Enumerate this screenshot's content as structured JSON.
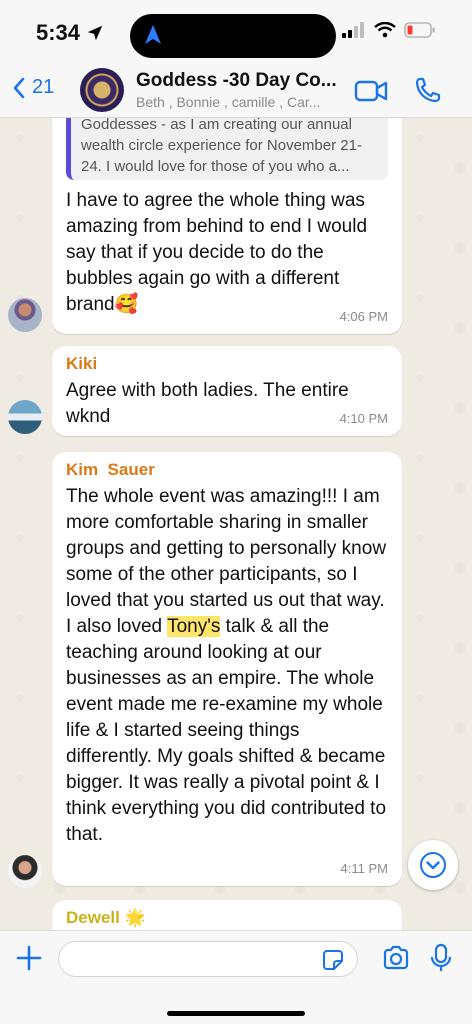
{
  "status_bar": {
    "time": "5:34"
  },
  "header": {
    "back_count": "21",
    "title": "Goddess -30 Day Co...",
    "subtitle": "Beth , Bonnie , camille , Car..."
  },
  "messages": [
    {
      "quote": "Goddesses - as I am creating our annual wealth circle experience for November 21-24. I would love for those of you who a...",
      "text": "I have to agree the whole thing was amazing from behind to end I would say that if you decide to do the bubbles again go with a different brand🥰",
      "time": "4:06 PM"
    },
    {
      "sender": "Kiki",
      "sender_color": "#d97a18",
      "text": "Agree with both ladies. The entire wknd",
      "time": "4:10 PM"
    },
    {
      "sender": "Kim  Sauer",
      "sender_color": "#d97a18",
      "text_before": "The whole event was amazing!!! I am more comfortable sharing in smaller groups and getting to personally know some of the other participants, so I loved that you started us out that way. I also loved ",
      "highlight": "Tony's",
      "text_after": " talk & all the teaching around looking at our businesses as an empire.  The whole event made me re-examine my whole life & I started seeing things differently. My goals shifted & became bigger. It was really a pivotal point & I think everything you did contributed to that.",
      "time": "4:11 PM"
    },
    {
      "sender": "Dewell 🌟",
      "sender_color": "#c9b21a"
    }
  ],
  "composer": {
    "placeholder": ""
  },
  "colors": {
    "accent": "#1a73e8",
    "quote_bar": "#5b4bd8",
    "highlight": "#ffe66b"
  }
}
